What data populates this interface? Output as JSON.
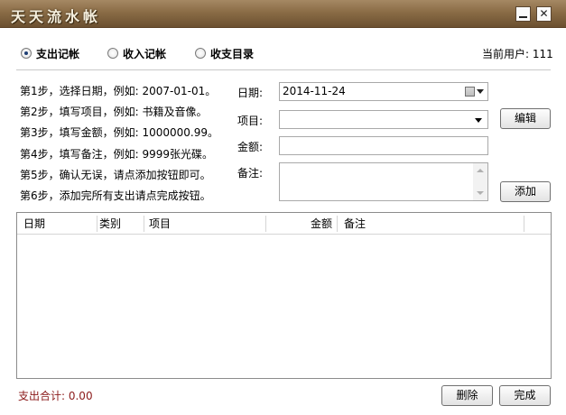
{
  "window": {
    "title": "天天流水帐",
    "minimize_label": "_",
    "close_label": "✕"
  },
  "tabs": [
    {
      "label": "支出记帐",
      "selected": true
    },
    {
      "label": "收入记帐",
      "selected": false
    },
    {
      "label": "收支目录",
      "selected": false
    }
  ],
  "current_user": "当前用户: 111",
  "steps": [
    "第1步，选择日期，例如: 2007-01-01。",
    "第2步，填写项目，例如: 书籍及音像。",
    "第3步，填写金额，例如: 1000000.99。",
    "第4步，填写备注，例如: 9999张光碟。",
    "第5步，确认无误，请点添加按钮即可。",
    "第6步，添加完所有支出请点完成按钮。"
  ],
  "form": {
    "date_label": "日期:",
    "date_value": "2014-11-24",
    "project_label": "项目:",
    "project_value": "",
    "amount_label": "金额:",
    "amount_value": "",
    "note_label": "备注:",
    "note_value": ""
  },
  "buttons": {
    "edit": "编辑",
    "add": "添加",
    "delete": "删除",
    "done": "完成"
  },
  "table": {
    "columns": [
      "日期",
      "类别",
      "项目",
      "金额",
      "备注"
    ],
    "rows": []
  },
  "total": "支出合计: 0.00",
  "colors": {
    "title_bar": "#8a6c46",
    "total_text": "#8b1a1a"
  },
  "icons": {
    "calendar": "calendar-icon",
    "dropdown": "chevron-down-icon"
  }
}
